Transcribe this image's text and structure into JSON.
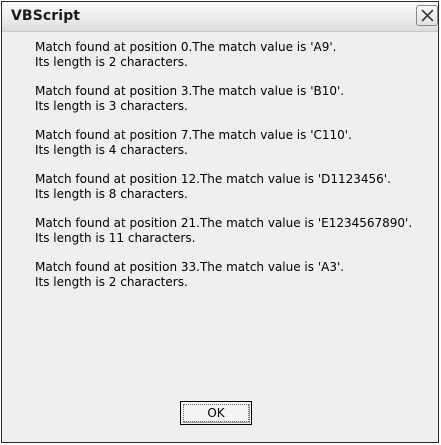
{
  "window": {
    "title": "VBScript",
    "close_icon": "close-icon"
  },
  "message": {
    "lines": [
      {
        "match": "Match found at position 0.The match value is 'A9'.",
        "length": "Its length is 2 characters."
      },
      {
        "match": "Match found at position 3.The match value is 'B10'.",
        "length": "Its length is 3 characters."
      },
      {
        "match": "Match found at position 7.The match value is 'C110'.",
        "length": "Its length is 4 characters."
      },
      {
        "match": "Match found at position 12.The match value is 'D1123456'.",
        "length": "Its length is 8 characters."
      },
      {
        "match": "Match found at position 21.The match value is 'E1234567890'.",
        "length": "Its length is 11 characters."
      },
      {
        "match": "Match found at position 33.The match value is 'A3'.",
        "length": "Its length is 2 characters."
      }
    ]
  },
  "buttons": {
    "ok_label": "OK"
  }
}
